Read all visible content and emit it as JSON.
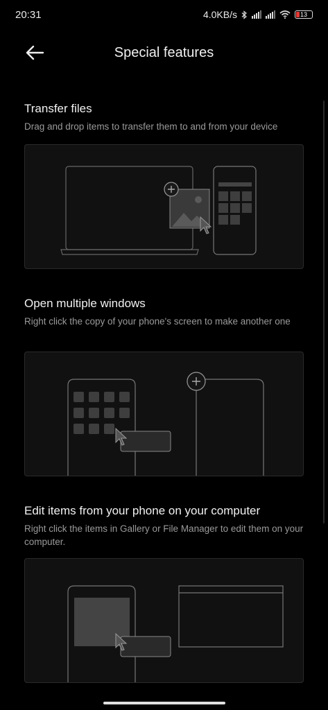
{
  "status": {
    "time": "20:31",
    "speed": "4.0KB/s",
    "battery": "13"
  },
  "header": {
    "title": "Special features"
  },
  "sections": [
    {
      "title": "Transfer files",
      "description": "Drag and drop items to transfer them to and from your device"
    },
    {
      "title": "Open multiple windows",
      "description": "Right click the copy of your phone's screen to make another one"
    },
    {
      "title": "Edit items from your phone on your computer",
      "description": "Right click the items in Gallery or File Manager to edit them on your computer."
    }
  ],
  "icons": [
    "back-arrow-icon",
    "bluetooth-icon",
    "signal-icon",
    "wifi-icon",
    "battery-icon",
    "plus-icon",
    "cursor-icon"
  ],
  "colors": {
    "background": "#000000",
    "card": "#111111",
    "battery_low": "#e53935"
  }
}
